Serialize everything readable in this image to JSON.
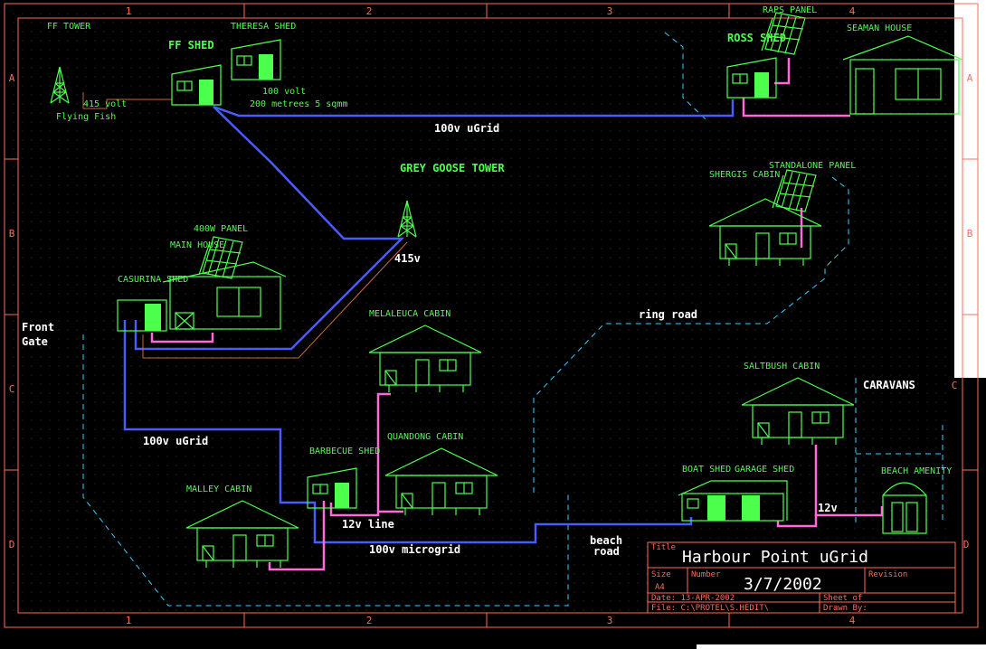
{
  "sheet": {
    "column_labels": [
      "1",
      "2",
      "3",
      "4"
    ],
    "row_labels": [
      "A",
      "B",
      "C",
      "D"
    ]
  },
  "buildings": {
    "ff_tower": "FF TOWER",
    "ff_shed": "FF SHED",
    "theresa_shed": "THERESA SHED",
    "ross_shed": "ROSS SHED",
    "raps_panel": "RAPS PANEL",
    "seaman_house": "SEAMAN HOUSE",
    "shergis_cabin": "SHERGIS CABIN",
    "standalone_panel": "STANDALONE PANEL",
    "grey_goose_tower": "GREY GOOSE TOWER",
    "panel_400w": "400W PANEL",
    "main_house": "MAIN HOUSE",
    "casurina_shed": "CASURINA SHED",
    "melaleuca_cabin": "MELALEUCA CABIN",
    "saltbush_cabin": "SALTBUSH CABIN",
    "quandong_cabin": "QUANDONG CABIN",
    "barbecue_shed": "BARBECUE SHED",
    "malley_cabin": "MALLEY CABIN",
    "boat_shed": "BOAT SHED",
    "garage_shed": "GARAGE SHED",
    "beach_amenity": "BEACH AMENITY",
    "caravans": "CARAVANS"
  },
  "labels": {
    "volt_415_top": "415 volt",
    "flying_fish": "Flying Fish",
    "volt_100": "100 volt",
    "cable_spec": "200 metrees 5 sqmm",
    "ugrid_top": "100v uGrid",
    "volt_415v": "415v",
    "ring_road": "ring road",
    "front_gate_1": "Front",
    "front_gate_2": "Gate",
    "ugrid_left": "100v uGrid",
    "line_12v": "12v line",
    "microgrid_100v": "100v microgrid",
    "beach_road_1": "beach",
    "beach_road_2": "road",
    "v12": "12v"
  },
  "title_block": {
    "title_caption": "Title",
    "title": "Harbour Point uGrid",
    "size_caption": "Size",
    "size": "A4",
    "number_caption": "Number",
    "number": "3/7/2002",
    "revision_caption": "Revision",
    "date": "Date: 13-APR-2002",
    "sheet": "Sheet of",
    "file": "File: C:\\PROTEL\\S.HEDIT\\",
    "drawn_by": "Drawn By:"
  },
  "colors": {
    "background": "#000000",
    "border": "#ff6a5a",
    "building": "#4cff4c",
    "ugrid_100v": "#4a5cff",
    "line_12v": "#ff6ad8",
    "road": "#39d0ff",
    "line_415v": "#c86a3a"
  }
}
